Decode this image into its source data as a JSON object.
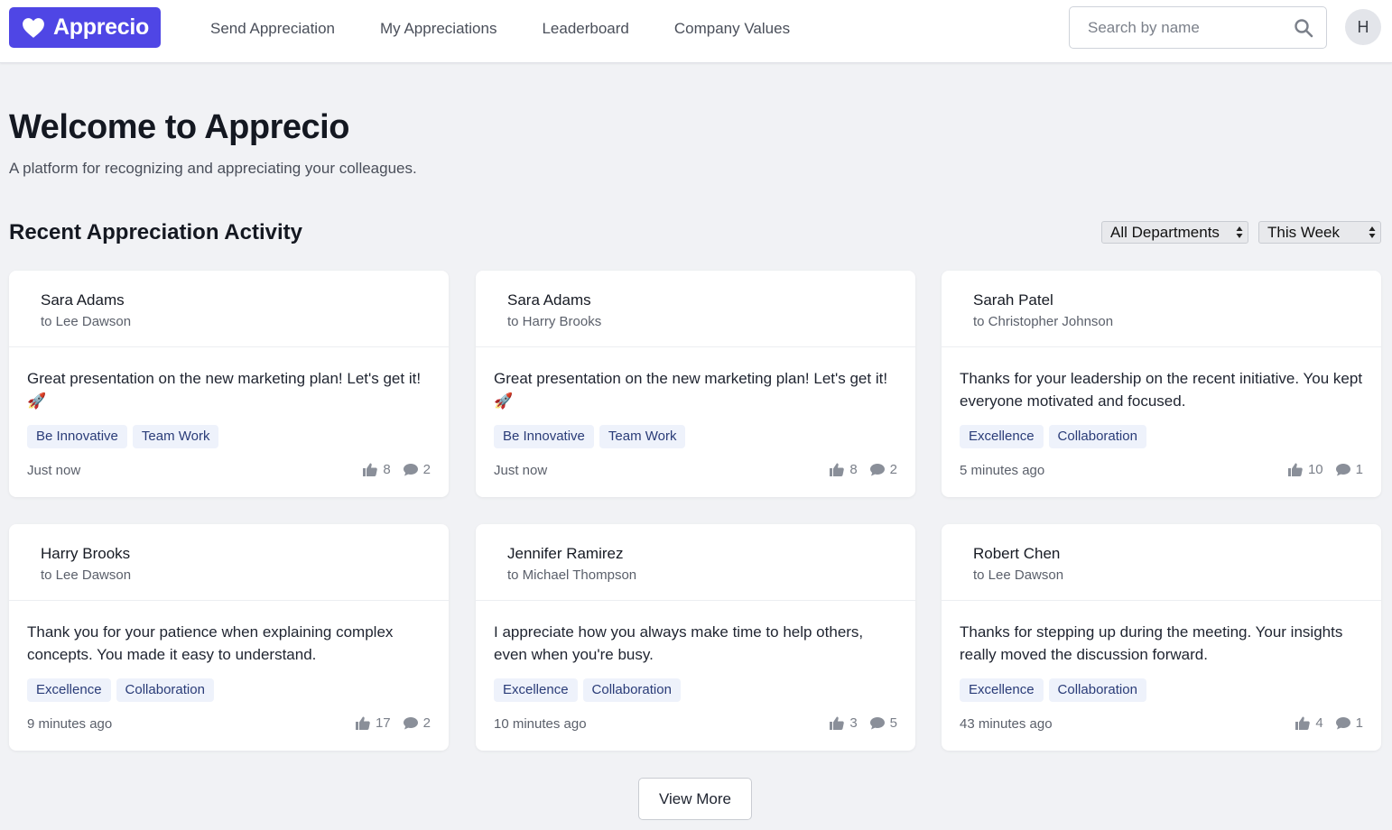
{
  "app": {
    "name": "Apprecio",
    "brand_color": "#4f46e5"
  },
  "nav": {
    "items": [
      "Send Appreciation",
      "My Appreciations",
      "Leaderboard",
      "Company Values"
    ]
  },
  "search": {
    "placeholder": "Search by name",
    "icon": "search-icon"
  },
  "user": {
    "avatar_initial": "H"
  },
  "hero": {
    "title": "Welcome to Apprecio",
    "subtitle": "A platform for recognizing and appreciating your colleagues."
  },
  "activity": {
    "title": "Recent Appreciation Activity",
    "filters": {
      "department": "All Departments",
      "period": "This Week"
    },
    "cards": [
      {
        "from": "Sara Adams",
        "to": "to Lee Dawson",
        "message": "Great presentation on the new marketing plan! Let's get it! 🚀",
        "tags": [
          "Be Innovative",
          "Team Work"
        ],
        "time": "Just now",
        "likes": "8",
        "comments": "2"
      },
      {
        "from": "Sara Adams",
        "to": "to Harry Brooks",
        "message": "Great presentation on the new marketing plan! Let's get it! 🚀",
        "tags": [
          "Be Innovative",
          "Team Work"
        ],
        "time": "Just now",
        "likes": "8",
        "comments": "2"
      },
      {
        "from": "Sarah Patel",
        "to": "to Christopher Johnson",
        "message": "Thanks for your leadership on the recent initiative. You kept everyone motivated and focused.",
        "tags": [
          "Excellence",
          "Collaboration"
        ],
        "time": "5 minutes ago",
        "likes": "10",
        "comments": "1"
      },
      {
        "from": "Harry Brooks",
        "to": "to Lee Dawson",
        "message": "Thank you for your patience when explaining complex concepts. You made it easy to understand.",
        "tags": [
          "Excellence",
          "Collaboration"
        ],
        "time": "9 minutes ago",
        "likes": "17",
        "comments": "2"
      },
      {
        "from": "Jennifer Ramirez",
        "to": "to Michael Thompson",
        "message": "I appreciate how you always make time to help others, even when you're busy.",
        "tags": [
          "Excellence",
          "Collaboration"
        ],
        "time": "10 minutes ago",
        "likes": "3",
        "comments": "5"
      },
      {
        "from": "Robert Chen",
        "to": "to Lee Dawson",
        "message": "Thanks for stepping up during the meeting. Your insights really moved the discussion forward.",
        "tags": [
          "Excellence",
          "Collaboration"
        ],
        "time": "43 minutes ago",
        "likes": "4",
        "comments": "1"
      }
    ],
    "view_more_label": "View More"
  }
}
